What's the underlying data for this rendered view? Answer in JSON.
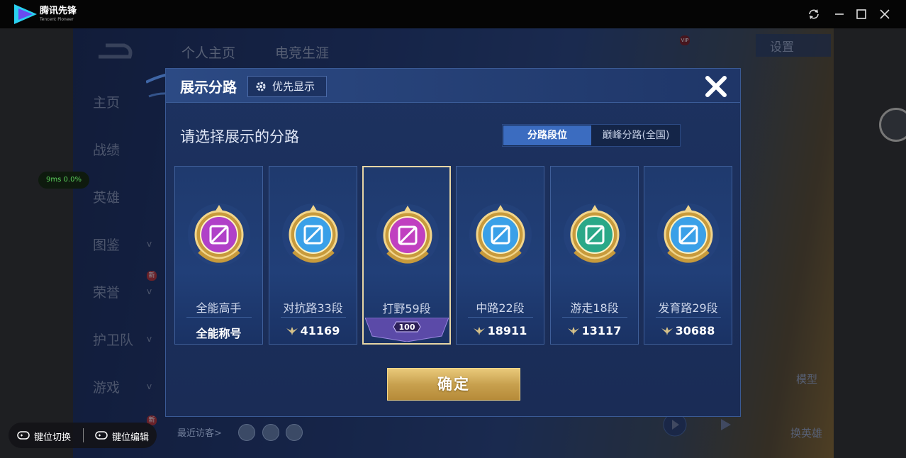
{
  "app": {
    "title": "腾讯先锋",
    "subtitle": "Tencent Pioneer"
  },
  "game": {
    "top_tabs": [
      "个人主页",
      "电竞生涯"
    ],
    "sidebar": [
      {
        "label": "主页"
      },
      {
        "label": "战绩"
      },
      {
        "label": "英雄"
      },
      {
        "label": "图鉴"
      },
      {
        "label": "荣誉"
      },
      {
        "label": "护卫队"
      },
      {
        "label": "游戏"
      }
    ],
    "settings_label": "设置",
    "net_status": "9ms  0.0%",
    "model_label": "模型",
    "change_hero_label": "换英雄",
    "visitors_label": "最近访客>",
    "new_badge": "新",
    "vip_label": "VIP"
  },
  "bottom_bar": {
    "key_switch": "键位切换",
    "key_edit": "键位编辑"
  },
  "dialog": {
    "title": "展示分路",
    "priority_label": "优先显示",
    "select_prompt": "请选择展示的分路",
    "segments": [
      "分路段位",
      "巅峰分路(全国)"
    ],
    "active_segment": "分路段位",
    "cards": [
      {
        "name": "全能高手",
        "value": "全能称号",
        "emblem": "allround-emblem-icon",
        "color": "#b040c8"
      },
      {
        "name": "对抗路33段",
        "value": "41169",
        "emblem": "clash-lane-emblem-icon",
        "color": "#3aa0e8"
      },
      {
        "name": "打野59段",
        "value": "100",
        "emblem": "jungle-emblem-icon",
        "color": "#c040c0"
      },
      {
        "name": "中路22段",
        "value": "18911",
        "emblem": "mid-lane-emblem-icon",
        "color": "#3aa0e8"
      },
      {
        "name": "游走18段",
        "value": "13117",
        "emblem": "roam-emblem-icon",
        "color": "#2aa888"
      },
      {
        "name": "发育路29段",
        "value": "30688",
        "emblem": "farm-lane-emblem-icon",
        "color": "#3aa0e8"
      }
    ],
    "selected_card": "打野59段",
    "confirm_label": "确定"
  }
}
